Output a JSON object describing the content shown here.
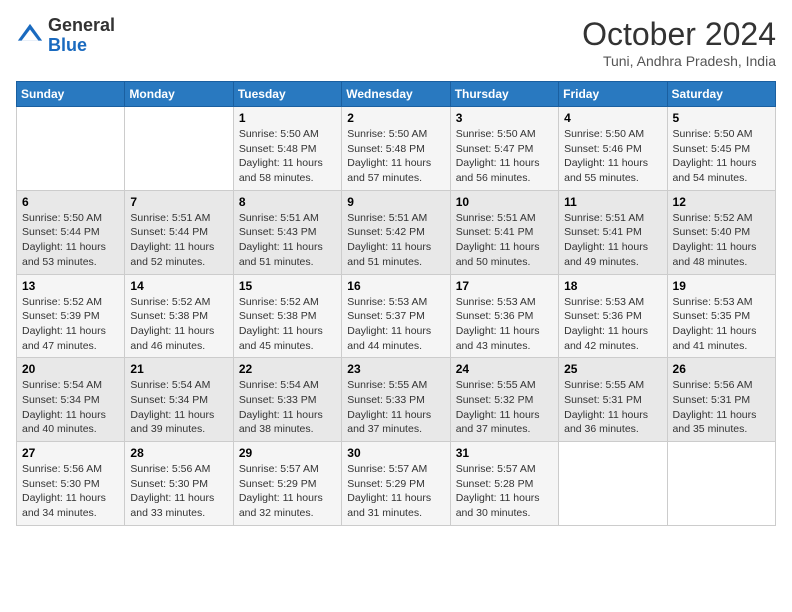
{
  "logo": {
    "general": "General",
    "blue": "Blue"
  },
  "title": "October 2024",
  "location": "Tuni, Andhra Pradesh, India",
  "weekdays": [
    "Sunday",
    "Monday",
    "Tuesday",
    "Wednesday",
    "Thursday",
    "Friday",
    "Saturday"
  ],
  "weeks": [
    [
      {
        "day": "",
        "content": ""
      },
      {
        "day": "",
        "content": ""
      },
      {
        "day": "1",
        "content": "Sunrise: 5:50 AM\nSunset: 5:48 PM\nDaylight: 11 hours and 58 minutes."
      },
      {
        "day": "2",
        "content": "Sunrise: 5:50 AM\nSunset: 5:48 PM\nDaylight: 11 hours and 57 minutes."
      },
      {
        "day": "3",
        "content": "Sunrise: 5:50 AM\nSunset: 5:47 PM\nDaylight: 11 hours and 56 minutes."
      },
      {
        "day": "4",
        "content": "Sunrise: 5:50 AM\nSunset: 5:46 PM\nDaylight: 11 hours and 55 minutes."
      },
      {
        "day": "5",
        "content": "Sunrise: 5:50 AM\nSunset: 5:45 PM\nDaylight: 11 hours and 54 minutes."
      }
    ],
    [
      {
        "day": "6",
        "content": "Sunrise: 5:50 AM\nSunset: 5:44 PM\nDaylight: 11 hours and 53 minutes."
      },
      {
        "day": "7",
        "content": "Sunrise: 5:51 AM\nSunset: 5:44 PM\nDaylight: 11 hours and 52 minutes."
      },
      {
        "day": "8",
        "content": "Sunrise: 5:51 AM\nSunset: 5:43 PM\nDaylight: 11 hours and 51 minutes."
      },
      {
        "day": "9",
        "content": "Sunrise: 5:51 AM\nSunset: 5:42 PM\nDaylight: 11 hours and 51 minutes."
      },
      {
        "day": "10",
        "content": "Sunrise: 5:51 AM\nSunset: 5:41 PM\nDaylight: 11 hours and 50 minutes."
      },
      {
        "day": "11",
        "content": "Sunrise: 5:51 AM\nSunset: 5:41 PM\nDaylight: 11 hours and 49 minutes."
      },
      {
        "day": "12",
        "content": "Sunrise: 5:52 AM\nSunset: 5:40 PM\nDaylight: 11 hours and 48 minutes."
      }
    ],
    [
      {
        "day": "13",
        "content": "Sunrise: 5:52 AM\nSunset: 5:39 PM\nDaylight: 11 hours and 47 minutes."
      },
      {
        "day": "14",
        "content": "Sunrise: 5:52 AM\nSunset: 5:38 PM\nDaylight: 11 hours and 46 minutes."
      },
      {
        "day": "15",
        "content": "Sunrise: 5:52 AM\nSunset: 5:38 PM\nDaylight: 11 hours and 45 minutes."
      },
      {
        "day": "16",
        "content": "Sunrise: 5:53 AM\nSunset: 5:37 PM\nDaylight: 11 hours and 44 minutes."
      },
      {
        "day": "17",
        "content": "Sunrise: 5:53 AM\nSunset: 5:36 PM\nDaylight: 11 hours and 43 minutes."
      },
      {
        "day": "18",
        "content": "Sunrise: 5:53 AM\nSunset: 5:36 PM\nDaylight: 11 hours and 42 minutes."
      },
      {
        "day": "19",
        "content": "Sunrise: 5:53 AM\nSunset: 5:35 PM\nDaylight: 11 hours and 41 minutes."
      }
    ],
    [
      {
        "day": "20",
        "content": "Sunrise: 5:54 AM\nSunset: 5:34 PM\nDaylight: 11 hours and 40 minutes."
      },
      {
        "day": "21",
        "content": "Sunrise: 5:54 AM\nSunset: 5:34 PM\nDaylight: 11 hours and 39 minutes."
      },
      {
        "day": "22",
        "content": "Sunrise: 5:54 AM\nSunset: 5:33 PM\nDaylight: 11 hours and 38 minutes."
      },
      {
        "day": "23",
        "content": "Sunrise: 5:55 AM\nSunset: 5:33 PM\nDaylight: 11 hours and 37 minutes."
      },
      {
        "day": "24",
        "content": "Sunrise: 5:55 AM\nSunset: 5:32 PM\nDaylight: 11 hours and 37 minutes."
      },
      {
        "day": "25",
        "content": "Sunrise: 5:55 AM\nSunset: 5:31 PM\nDaylight: 11 hours and 36 minutes."
      },
      {
        "day": "26",
        "content": "Sunrise: 5:56 AM\nSunset: 5:31 PM\nDaylight: 11 hours and 35 minutes."
      }
    ],
    [
      {
        "day": "27",
        "content": "Sunrise: 5:56 AM\nSunset: 5:30 PM\nDaylight: 11 hours and 34 minutes."
      },
      {
        "day": "28",
        "content": "Sunrise: 5:56 AM\nSunset: 5:30 PM\nDaylight: 11 hours and 33 minutes."
      },
      {
        "day": "29",
        "content": "Sunrise: 5:57 AM\nSunset: 5:29 PM\nDaylight: 11 hours and 32 minutes."
      },
      {
        "day": "30",
        "content": "Sunrise: 5:57 AM\nSunset: 5:29 PM\nDaylight: 11 hours and 31 minutes."
      },
      {
        "day": "31",
        "content": "Sunrise: 5:57 AM\nSunset: 5:28 PM\nDaylight: 11 hours and 30 minutes."
      },
      {
        "day": "",
        "content": ""
      },
      {
        "day": "",
        "content": ""
      }
    ]
  ]
}
